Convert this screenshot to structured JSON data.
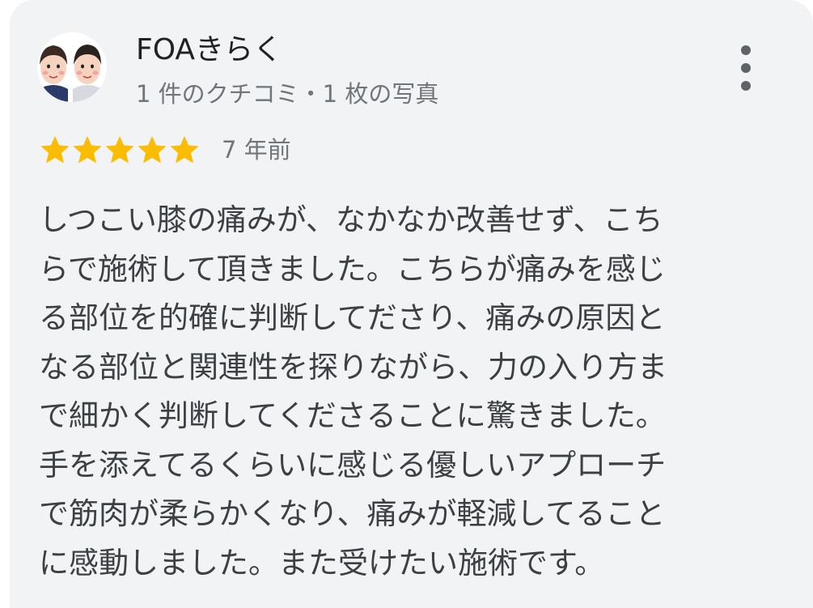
{
  "author": {
    "name": "FOAきらく",
    "meta": "1 件のクチコミ・1 枚の写真"
  },
  "review": {
    "rating": 5,
    "rating_max": 5,
    "age": "7 年前",
    "lines": [
      "しつこい膝の痛みが、なかなか改善せず、こち",
      "らで施術して頂きました。こちらが痛みを感じ",
      "る部位を的確に判断してださり、痛みの原因と",
      "なる部位と関連性を探りながら、力の入り方ま",
      "で細かく判断してくださることに驚きました。",
      "手を添えてるくらいに感じる優しいアプローチ",
      "で筋肉が柔らかくなり、痛みが軽減してること",
      "に感動しました。また受けたい施術です。"
    ]
  },
  "icons": {
    "avatar": "avatar-two-people",
    "more": "more-vert-icon",
    "star": "star-icon"
  },
  "colors": {
    "card_background": "#f1f3f4",
    "star": "#fbbc04",
    "text": "#3c4043",
    "secondary_text": "#70757a"
  }
}
